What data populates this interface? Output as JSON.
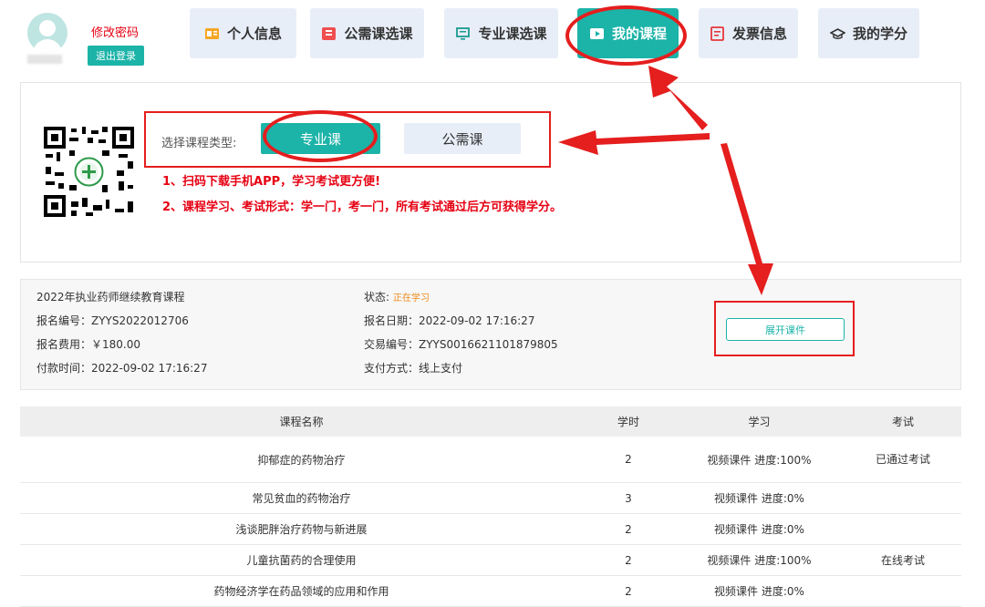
{
  "header": {
    "change_password": "修改密码",
    "logout": "退出登录",
    "nav": [
      {
        "label": "个人信息",
        "icon": "id-card-icon"
      },
      {
        "label": "公需课选课",
        "icon": "book-icon"
      },
      {
        "label": "专业课选课",
        "icon": "monitor-icon"
      },
      {
        "label": "我的课程",
        "icon": "play-icon",
        "active": true
      },
      {
        "label": "发票信息",
        "icon": "invoice-icon"
      },
      {
        "label": "我的学分",
        "icon": "graduation-cap-icon"
      }
    ]
  },
  "course_type": {
    "label": "选择课程类型:",
    "major_label": "专业课",
    "public_label": "公需课"
  },
  "notices": [
    "1、扫码下载手机APP，学习考试更方便!",
    "2、课程学习、考试形式：学一门，考一门，所有考试通过后方可获得学分。"
  ],
  "order": {
    "title": "2022年执业药师继续教育课程",
    "reg_no": "报名编号：ZYYS2022012706",
    "fee": "报名费用：￥180.00",
    "pay_time": "付款时间：2022-09-02 17:16:27",
    "status_label": "状态:",
    "status_value": "正在学习",
    "reg_date": "报名日期：2022-09-02 17:16:27",
    "trade_no": "交易编号：ZYYS0016621101879805",
    "pay_method": "支付方式：线上支付",
    "expand_label": "展开课件"
  },
  "table": {
    "headers": [
      "课程名称",
      "学时",
      "学习",
      "考试"
    ],
    "rows": [
      {
        "name": "抑郁症的药物治疗",
        "hours": "2",
        "study": "视频课件 进度:100%",
        "exam": "已通过考试"
      },
      {
        "name": "常见贫血的药物治疗",
        "hours": "3",
        "study": "视频课件 进度:0%",
        "exam": ""
      },
      {
        "name": "浅谈肥胖治疗药物与新进展",
        "hours": "2",
        "study": "视频课件 进度:0%",
        "exam": ""
      },
      {
        "name": "儿童抗菌药的合理使用",
        "hours": "2",
        "study": "视频课件 进度:100%",
        "exam": "在线考试"
      },
      {
        "name": "药物经济学在药品领域的应用和作用",
        "hours": "2",
        "study": "视频课件 进度:0%",
        "exam": ""
      }
    ]
  },
  "colors": {
    "teal": "#1cb3a8",
    "annotation_red": "#e51e1e",
    "status_orange": "#ef8a19"
  }
}
